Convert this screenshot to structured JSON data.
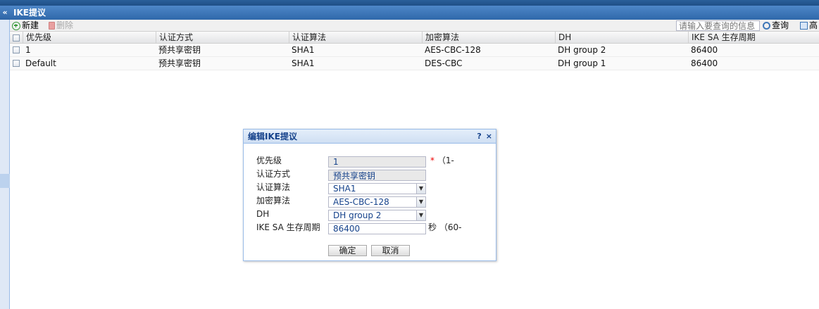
{
  "panel": {
    "title": "IKE提议",
    "collapse_glyph": "«"
  },
  "toolbar": {
    "add_label": "新建",
    "delete_label": "删除",
    "search_placeholder": "请输入要查询的信息",
    "search_label": "查询",
    "advanced_label": "高"
  },
  "grid": {
    "columns": [
      "优先级",
      "认证方式",
      "认证算法",
      "加密算法",
      "DH",
      "IKE SA 生存周期"
    ],
    "rows": [
      {
        "priority": "1",
        "auth_method": "预共享密钥",
        "auth_alg": "SHA1",
        "enc_alg": "AES-CBC-128",
        "dh": "DH group 2",
        "lifetime": "86400"
      },
      {
        "priority": "Default",
        "auth_method": "预共享密钥",
        "auth_alg": "SHA1",
        "enc_alg": "DES-CBC",
        "dh": "DH group 1",
        "lifetime": "86400"
      }
    ]
  },
  "dialog": {
    "title": "编辑IKE提议",
    "help_glyph": "?",
    "close_glyph": "×",
    "labels": {
      "priority": "优先级",
      "auth_method": "认证方式",
      "auth_alg": "认证算法",
      "enc_alg": "加密算法",
      "dh": "DH",
      "lifetime": "IKE SA 生存周期"
    },
    "values": {
      "priority": "1",
      "auth_method": "预共享密钥",
      "auth_alg": "SHA1",
      "enc_alg": "AES-CBC-128",
      "dh": "DH group 2",
      "lifetime": "86400"
    },
    "required_mark": "*",
    "priority_hint": "（1-",
    "lifetime_unit": "秒",
    "lifetime_hint": "（60-",
    "ok_label": "确定",
    "cancel_label": "取消"
  },
  "colors": {
    "header_blue": "#2f68aa",
    "dialog_title": "#15428b",
    "required": "#ee0000"
  }
}
